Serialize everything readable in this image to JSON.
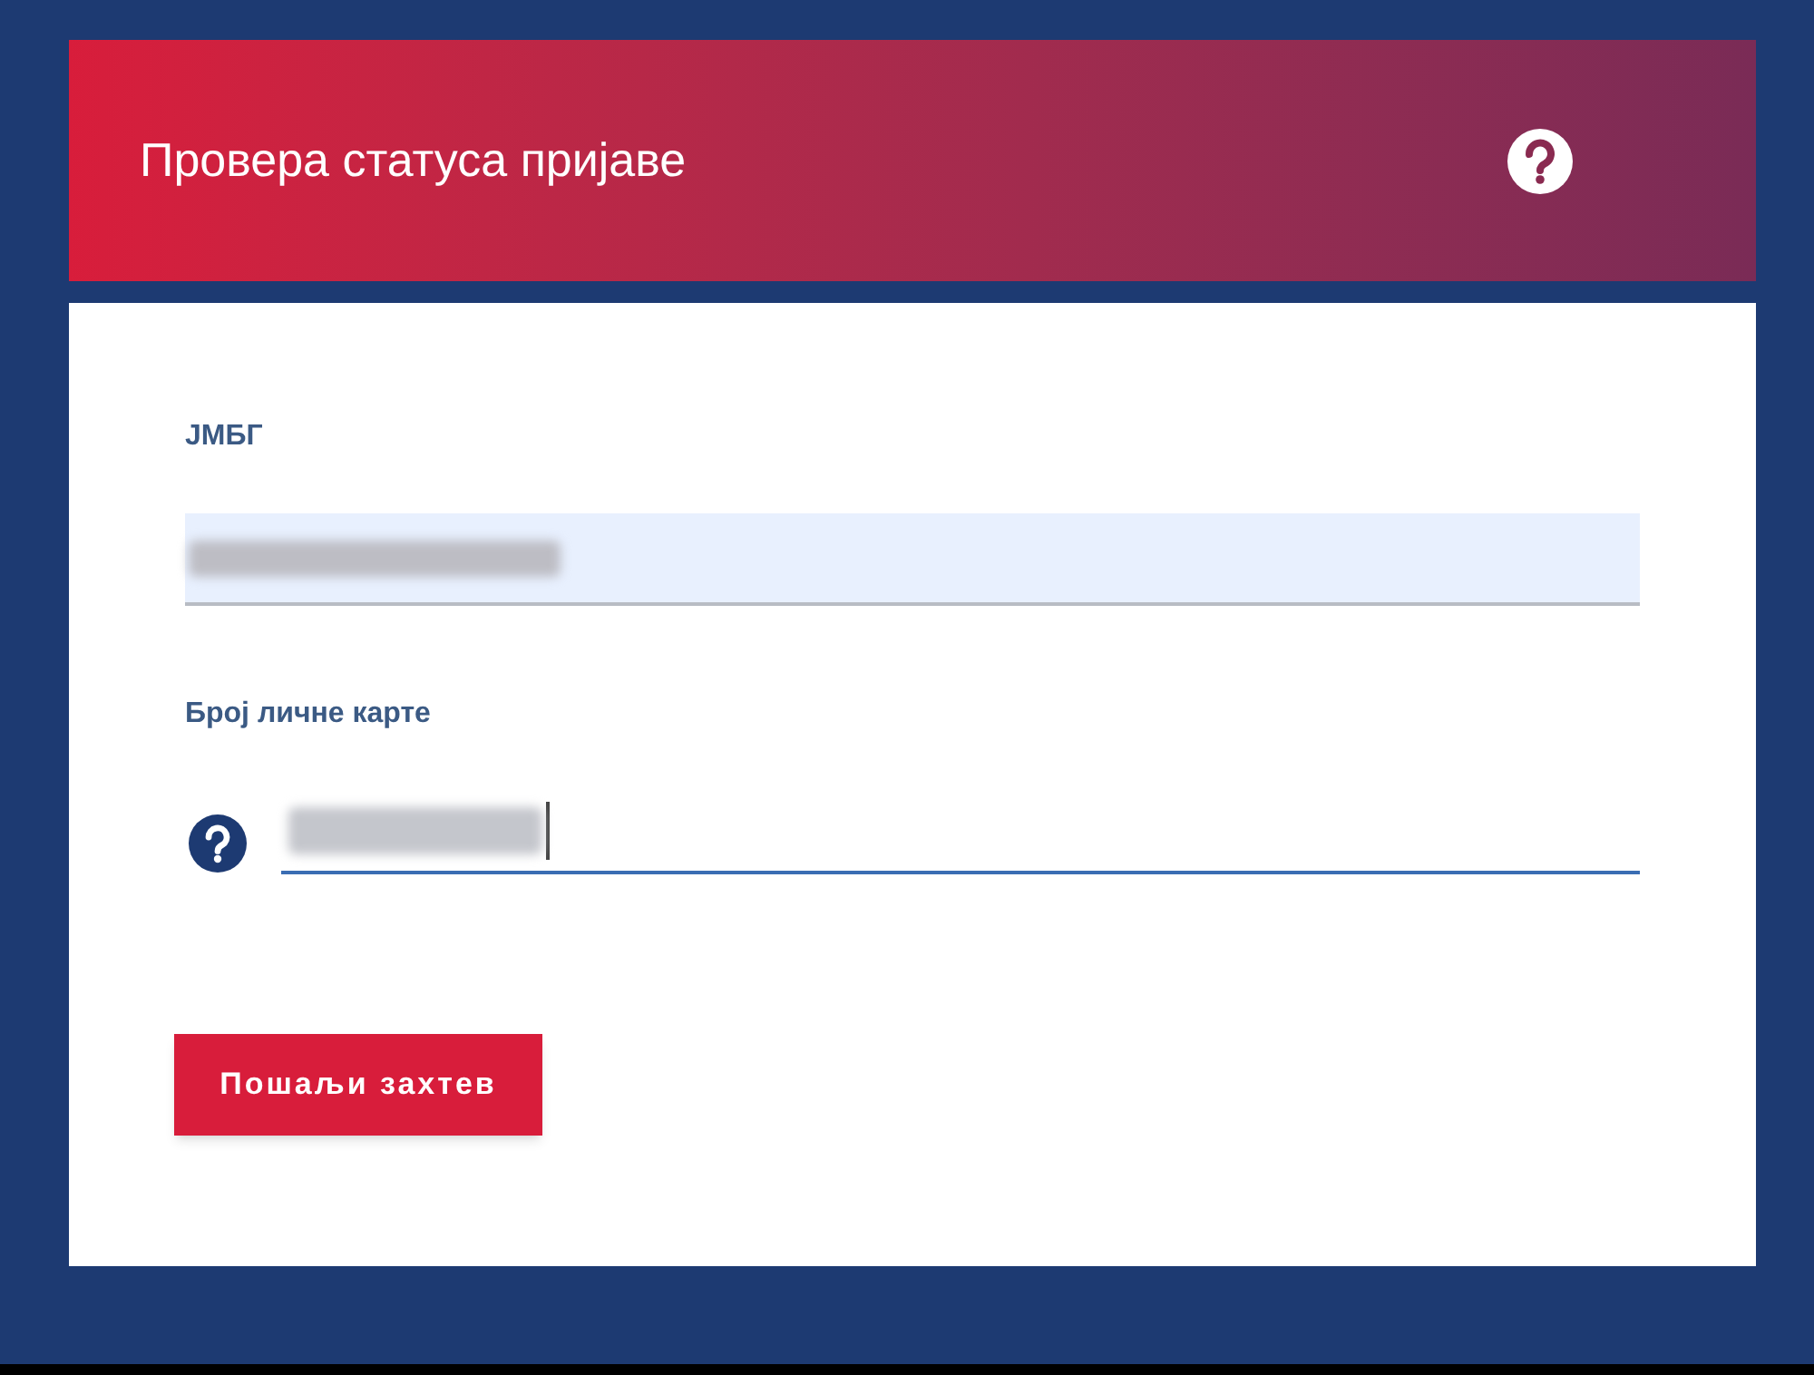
{
  "header": {
    "title": "Провера статуса пријаве"
  },
  "fields": [
    {
      "label": "ЈМБГ",
      "kind": "autofilled",
      "value_blurred": true,
      "help_icon": false,
      "focused": false
    },
    {
      "label": "Број личне карте",
      "kind": "plain",
      "value_blurred": true,
      "help_icon": true,
      "focused": true
    }
  ],
  "submit": {
    "label": "Пошаљи захтев"
  }
}
